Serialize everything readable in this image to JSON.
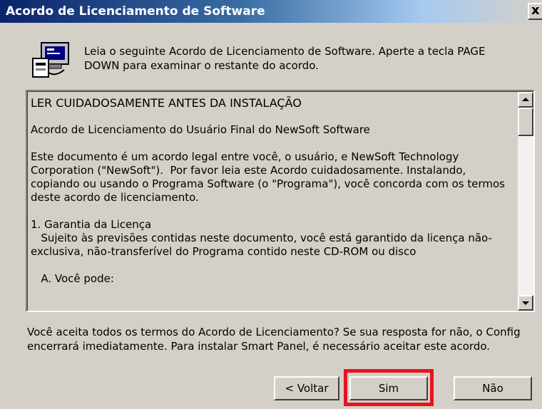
{
  "window": {
    "title": "Acordo de Licenciamento de Software",
    "close_label": "x"
  },
  "header": {
    "icon": "setup-computer-icon",
    "intro_text": "Leia o seguinte Acordo de Licenciamento de Software. Aperte a tecla PAGE DOWN para examinar o restante do acordo."
  },
  "license": {
    "paragraphs": [
      "LER CUIDADOSAMENTE ANTES DA INSTALAÇÃO",
      "Acordo de Licenciamento do Usuário Final do NewSoft Software",
      "Este documento é um acordo legal entre você, o usuário, e NewSoft Technology Corporation (\"NewSoft\").  Por favor leia este Acordo cuidadosamente. Instalando, copiando ou usando o Programa Software (o \"Programa\"), você concorda com os termos deste acordo de licenciamento.",
      "1. Garantia da Licença\n   Sujeito às previsões contidas neste documento, você está garantido da licença não-exclusiva, não-transferível do Programa contido neste CD-ROM ou disco",
      "   A. Você pode:"
    ]
  },
  "question": "Você aceita todos os termos do Acordo de Licenciamento? Se sua resposta for não, o Config encerrará imediatamente. Para instalar Smart Panel, é necessário aceitar este acordo.",
  "buttons": {
    "back": "< Voltar",
    "yes": "Sim",
    "no": "Não"
  },
  "colors": {
    "highlight": "#e8141c",
    "titlebar": "#0a246a"
  }
}
